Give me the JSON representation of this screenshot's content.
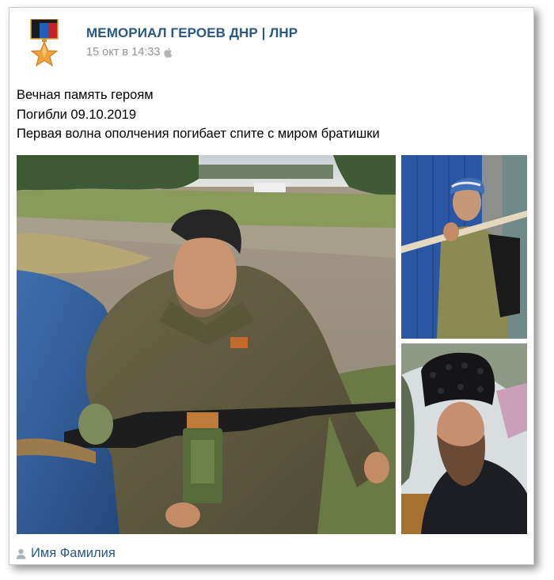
{
  "post": {
    "author": "МЕМОРИАЛ ГЕРОЕВ ДНР | ЛНР",
    "timestamp": "15 окт в 14:33",
    "platform_icon": "apple-icon",
    "text_lines": [
      "Вечная память героям",
      "Погибли 09.10.2019",
      "Первая волна ополчения погибает спите с миром братишки"
    ],
    "photos": [
      "main-photo",
      "top-right-photo",
      "bottom-right-photo"
    ],
    "signature_icon": "user-icon",
    "signature": "Имя Фамилия"
  },
  "colors": {
    "link": "#2a5885",
    "muted": "#939393",
    "text": "#000000"
  }
}
